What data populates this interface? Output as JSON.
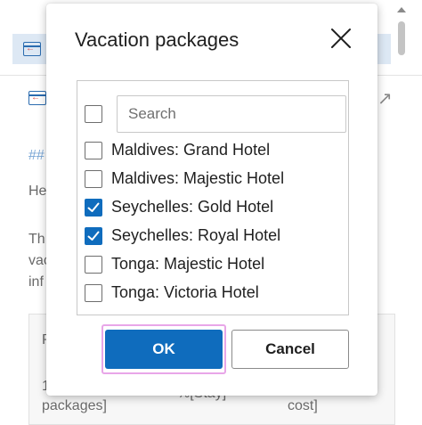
{
  "background": {
    "heading_fragment": "##",
    "text_lines": [
      "He",
      "Th",
      "vac",
      "inf"
    ],
    "table": {
      "header_fragment": "P",
      "cells": [
        "1",
        "packages]",
        "%[Stay]",
        "cost]"
      ]
    }
  },
  "dialog": {
    "title": "Vacation packages",
    "search": {
      "placeholder": "Search",
      "value": ""
    },
    "options": [
      {
        "label": "Maldives: Grand Hotel",
        "checked": false
      },
      {
        "label": "Maldives: Majestic Hotel",
        "checked": false
      },
      {
        "label": "Seychelles: Gold Hotel",
        "checked": true
      },
      {
        "label": "Seychelles: Royal Hotel",
        "checked": true
      },
      {
        "label": "Tonga: Majestic Hotel",
        "checked": false
      },
      {
        "label": "Tonga: Victoria Hotel",
        "checked": false
      }
    ],
    "ok_label": "OK",
    "cancel_label": "Cancel"
  },
  "colors": {
    "accent": "#0f6cbd",
    "focus_ring": "#e8a6e8",
    "selected_row_bg": "#dde8f4"
  },
  "icons": {
    "close": "close-icon",
    "checkmark": "checkmark-icon",
    "expand": "expand-icon",
    "row_icon": "table-row-icon"
  }
}
